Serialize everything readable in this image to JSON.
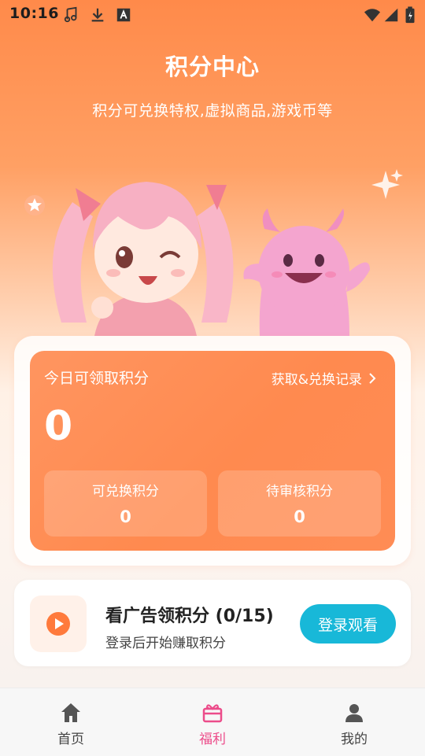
{
  "status_bar": {
    "time": "10:16",
    "icons": [
      "music-note-icon",
      "download-icon",
      "keyboard-icon",
      "wifi-icon",
      "signal-icon",
      "battery-icon"
    ]
  },
  "header": {
    "title": "积分中心",
    "subtitle": "积分可兑换特权,虚拟商品,游戏币等"
  },
  "points_card": {
    "today_label": "今日可领取积分",
    "record_link": "获取&兑换记录",
    "today_value": "0",
    "redeemable_label": "可兑换积分",
    "redeemable_value": "0",
    "pending_label": "待审核积分",
    "pending_value": "0"
  },
  "ad_task": {
    "title": "看广告领积分 (0/15)",
    "description": "登录后开始赚取积分",
    "button_label": "登录观看",
    "icon": "play-icon"
  },
  "bottom_nav": {
    "active": "福利",
    "items": [
      {
        "label": "首页",
        "icon": "home-icon"
      },
      {
        "label": "福利",
        "icon": "gift-icon"
      },
      {
        "label": "我的",
        "icon": "user-icon"
      }
    ]
  },
  "colors": {
    "accent_orange": "#ff8a4f",
    "button_cyan": "#18b8d8",
    "nav_active": "#ec4c8a"
  }
}
